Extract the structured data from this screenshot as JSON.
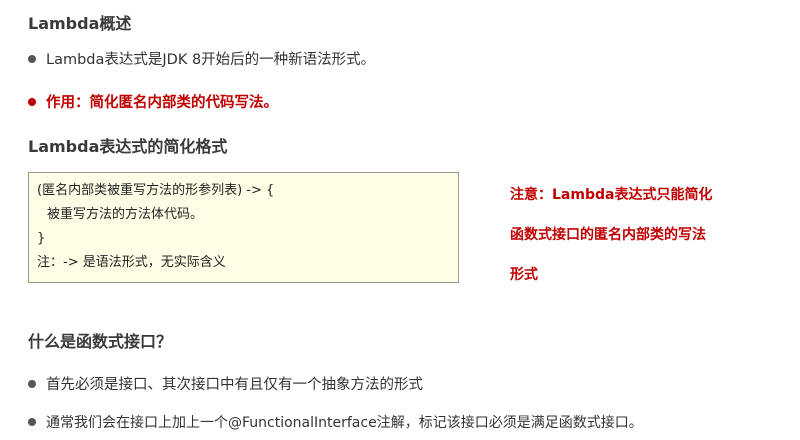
{
  "overview": {
    "title": "Lambda概述",
    "bullet1": "Lambda表达式是JDK 8开始后的一种新语法形式。",
    "bullet2": "作用：简化匿名内部类的代码写法。"
  },
  "format_section": {
    "title": "Lambda表达式的简化格式",
    "code_lines": [
      "(匿名内部类被重写方法的形参列表) -> {",
      "被重写方法的方法体代码。",
      "}",
      "注：-> 是语法形式，无实际含义"
    ],
    "note_lines": [
      "注意：Lambda表达式只能简化",
      "函数式接口的匿名内部类的写法",
      "形式"
    ]
  },
  "functional_interface": {
    "title": "什么是函数式接口？",
    "bullet1": "首先必须是接口、其次接口中有且仅有一个抽象方法的形式",
    "bullet2": "通常我们会在接口上加上一个@FunctionalInterface注解，标记该接口必须是满足函数式接口。"
  },
  "colors": {
    "accent_red": "#c00000",
    "code_background": "#fffde6"
  }
}
